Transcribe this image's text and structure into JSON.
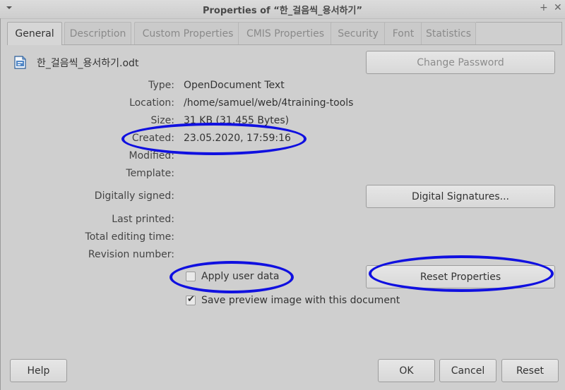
{
  "window": {
    "title": "Properties of “한_걸음씩_용서하기”",
    "menu_icon": "menu-arrow-icon",
    "pin_icon": "+",
    "close_icon": "✕"
  },
  "tabs": [
    {
      "label": "General",
      "active": true
    },
    {
      "label": "Description",
      "active": false
    },
    {
      "label": "Custom Properties",
      "active": false
    },
    {
      "label": "CMIS Properties",
      "active": false
    },
    {
      "label": "Security",
      "active": false
    },
    {
      "label": "Font",
      "active": false
    },
    {
      "label": "Statistics",
      "active": false
    }
  ],
  "file": {
    "icon": "writer-document-icon",
    "name": "한_걸음씩_용서하기.odt"
  },
  "properties": {
    "type_label": "Type:",
    "type_value": "OpenDocument Text",
    "location_label": "Location:",
    "location_value": "/home/samuel/web/4training-tools",
    "size_label": "Size:",
    "size_value": "31 KB (31,455 Bytes)",
    "created_label": "Created:",
    "created_value": "23.05.2020, 17:59:16",
    "modified_label": "Modified:",
    "modified_value": "",
    "template_label": "Template:",
    "template_value": "",
    "signed_label": "Digitally signed:",
    "signed_value": "",
    "printed_label": "Last printed:",
    "printed_value": "",
    "editing_label": "Total editing time:",
    "editing_value": "",
    "revision_label": "Revision number:",
    "revision_value": ""
  },
  "buttons": {
    "change_password": "Change Password",
    "digital_signatures": "Digital Signatures...",
    "reset_properties": "Reset Properties",
    "help": "Help",
    "ok": "OK",
    "cancel": "Cancel",
    "reset": "Reset"
  },
  "checkboxes": {
    "apply_user_data": {
      "label": "Apply user data",
      "checked": false
    },
    "save_preview": {
      "label": "Save preview image with this document",
      "checked": true
    }
  },
  "annotations": {
    "color": "#1010e0",
    "highlighted": [
      "created",
      "apply-user-data",
      "reset-properties"
    ]
  }
}
